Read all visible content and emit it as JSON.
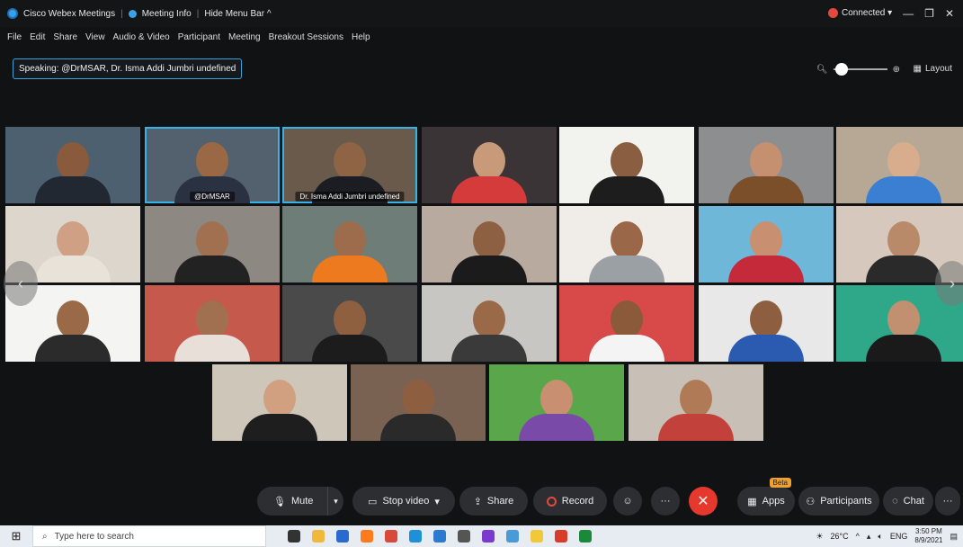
{
  "titlebar": {
    "app_name": "Cisco Webex Meetings",
    "meeting_info": "Meeting Info",
    "hide_menu_bar": "Hide Menu Bar ^",
    "connection_status": "Connected",
    "status_color": "#e5483f"
  },
  "menu": [
    "File",
    "Edit",
    "Share",
    "View",
    "Audio & Video",
    "Participant",
    "Meeting",
    "Breakout Sessions",
    "Help"
  ],
  "speaking": {
    "text": "Speaking: @DrMSAR, Dr. Isma Addi Jumbri undefined"
  },
  "layout": {
    "label": "Layout"
  },
  "tiles": [
    {
      "name": "",
      "bg": "#4c6070",
      "skin": "#8a5a3c",
      "shirt": "#222831",
      "active": false
    },
    {
      "name": "@DrMSAR",
      "bg": "#52616d",
      "skin": "#9a6845",
      "shirt": "#2a3140",
      "active": true
    },
    {
      "name": "Dr. Isma Addi Jumbri undefined",
      "bg": "#6a5a4c",
      "skin": "#8f6444",
      "shirt": "#1c1d22",
      "active": true
    },
    {
      "name": "",
      "bg": "#3b3436",
      "skin": "#c99a7a",
      "shirt": "#d63b3b",
      "active": false
    },
    {
      "name": "",
      "bg": "#f2f2ee",
      "skin": "#8a5e40",
      "shirt": "#1d1d1d",
      "active": false
    },
    {
      "name": "",
      "bg": "#8c8e90",
      "skin": "#c49070",
      "shirt": "#7a4f2a",
      "active": false
    },
    {
      "name": "",
      "bg": "#b7a896",
      "skin": "#d8ad8e",
      "shirt": "#3a7fd1",
      "active": false
    },
    {
      "name": "",
      "bg": "#dcd6cc",
      "skin": "#d0a085",
      "shirt": "#e8e2d8",
      "active": false
    },
    {
      "name": "",
      "bg": "#8e8882",
      "skin": "#a07050",
      "shirt": "#222",
      "active": false
    },
    {
      "name": "",
      "bg": "#6f7d78",
      "skin": "#9c6c4c",
      "shirt": "#ee7a20",
      "active": false
    },
    {
      "name": "",
      "bg": "#b9aaa0",
      "skin": "#8e6042",
      "shirt": "#1b1b1b",
      "active": false
    },
    {
      "name": "",
      "bg": "#f0ece8",
      "skin": "#9a6848",
      "shirt": "#9aa0a4",
      "active": false
    },
    {
      "name": "",
      "bg": "#6fb7d8",
      "skin": "#c89070",
      "shirt": "#c52a3a",
      "active": false
    },
    {
      "name": "",
      "bg": "#d6c8bc",
      "skin": "#b88a6a",
      "shirt": "#2a2a2a",
      "active": false
    },
    {
      "name": "",
      "bg": "#f4f4f2",
      "skin": "#9a6a48",
      "shirt": "#2b2b2b",
      "active": false
    },
    {
      "name": "",
      "bg": "#c55a4c",
      "skin": "#a07050",
      "shirt": "#e8e0d8",
      "active": false
    },
    {
      "name": "",
      "bg": "#4a4a4a",
      "skin": "#8e6040",
      "shirt": "#1c1c1c",
      "active": false
    },
    {
      "name": "",
      "bg": "#c8c6c2",
      "skin": "#9a6a48",
      "shirt": "#3a3a3a",
      "active": false
    },
    {
      "name": "",
      "bg": "#d84a4a",
      "skin": "#8a5a3a",
      "shirt": "#f4f4f4",
      "active": false
    },
    {
      "name": "",
      "bg": "#e8e8e8",
      "skin": "#8e5e40",
      "shirt": "#2a5bb0",
      "active": false
    },
    {
      "name": "",
      "bg": "#2fa88a",
      "skin": "#c09070",
      "shirt": "#1a1a1a",
      "active": false
    },
    {
      "name": "",
      "bg": "#cfc6ba",
      "skin": "#d0a080",
      "shirt": "#1e1e1e",
      "active": false
    },
    {
      "name": "",
      "bg": "#7a6252",
      "skin": "#8e5e40",
      "shirt": "#2a2a2a",
      "active": false
    },
    {
      "name": "",
      "bg": "#5aa64a",
      "skin": "#c89070",
      "shirt": "#7a4aa8",
      "active": false
    },
    {
      "name": "",
      "bg": "#c8bfb6",
      "skin": "#b07a56",
      "shirt": "#c2413a",
      "active": false
    }
  ],
  "controls": {
    "mute": "Mute",
    "stop_video": "Stop video",
    "share": "Share",
    "record": "Record",
    "apps": "Apps",
    "apps_badge": "Beta",
    "participants": "Participants",
    "chat": "Chat"
  },
  "taskbar": {
    "search_placeholder": "Type here to search",
    "temperature": "26°C",
    "language": "ENG",
    "time": "3:50 PM",
    "date": "8/9/2021",
    "icons": [
      "task-view-icon",
      "file-explorer-icon",
      "store-icon",
      "firefox-icon",
      "chrome-icon",
      "edge-icon",
      "mail-icon",
      "files-icon",
      "media-icon",
      "photos-icon",
      "sticky-notes-icon",
      "office-icon",
      "webex-icon"
    ],
    "icon_colors": [
      "#333",
      "#f0b93a",
      "#2a6ad0",
      "#ff7a1a",
      "#d9483b",
      "#1e90d8",
      "#2a7ad0",
      "#555",
      "#7a3ad0",
      "#4a9ad8",
      "#f0c93a",
      "#d83b2a",
      "#1a8a3a"
    ]
  }
}
